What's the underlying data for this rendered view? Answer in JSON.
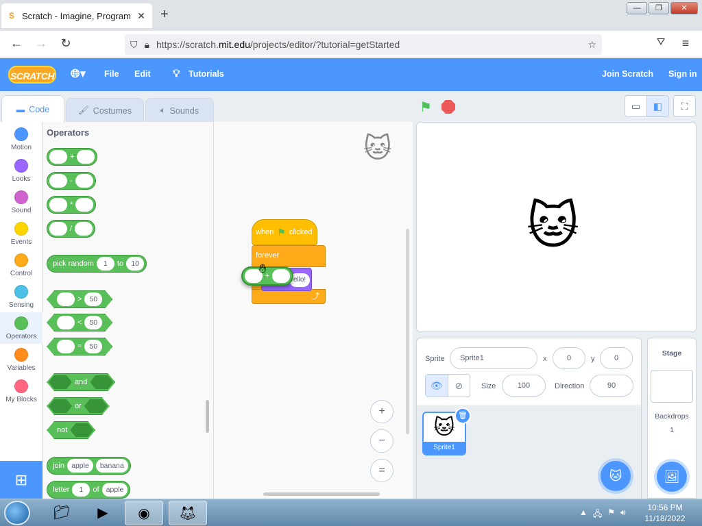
{
  "browser": {
    "tab_title": "Scratch - Imagine, Program, Sh",
    "url_prefix": "https://scratch.",
    "url_domain": "mit.edu",
    "url_path": "/projects/editor/?tutorial=getStarted"
  },
  "menu": {
    "logo": "SCRATCH",
    "file": "File",
    "edit": "Edit",
    "tutorials": "Tutorials",
    "join": "Join Scratch",
    "signin": "Sign in"
  },
  "editor_tabs": {
    "code": "Code",
    "costumes": "Costumes",
    "sounds": "Sounds"
  },
  "categories": [
    {
      "label": "Motion",
      "color": "#4c97ff"
    },
    {
      "label": "Looks",
      "color": "#9966ff"
    },
    {
      "label": "Sound",
      "color": "#cf63cf"
    },
    {
      "label": "Events",
      "color": "#ffd500"
    },
    {
      "label": "Control",
      "color": "#ffab19"
    },
    {
      "label": "Sensing",
      "color": "#4cbfe6"
    },
    {
      "label": "Operators",
      "color": "#59c059"
    },
    {
      "label": "Variables",
      "color": "#ff8c1a"
    },
    {
      "label": "My Blocks",
      "color": "#ff6680"
    }
  ],
  "palette": {
    "title": "Operators",
    "add": "+",
    "sub": "-",
    "mul": "*",
    "div": "/",
    "pick_random": "pick random",
    "pick_from": "1",
    "pick_to_label": "to",
    "pick_to": "10",
    "gt": ">",
    "lt": "<",
    "eq": "=",
    "cmp_value": "50",
    "and": "and",
    "or": "or",
    "not": "not",
    "join": "join",
    "join_a": "apple",
    "join_b": "banana",
    "letter": "letter",
    "letter_n": "1",
    "letter_of": "of",
    "letter_word": "apple"
  },
  "script": {
    "when": "when",
    "clicked": "clicked",
    "forever": "forever",
    "say_value": "ello!",
    "drag_op": "+"
  },
  "zoom": {
    "in": "+",
    "out": "−",
    "reset": "="
  },
  "sprite_info": {
    "sprite_label": "Sprite",
    "sprite_name": "Sprite1",
    "x_label": "x",
    "x_value": "0",
    "y_label": "y",
    "y_value": "0",
    "size_label": "Size",
    "size_value": "100",
    "direction_label": "Direction",
    "direction_value": "90"
  },
  "sprite_list": [
    {
      "name": "Sprite1"
    }
  ],
  "stage_pane": {
    "title": "Stage",
    "backdrops_label": "Backdrops",
    "backdrops_count": "1"
  },
  "taskbar": {
    "time": "10:56 PM",
    "date": "11/18/2022"
  }
}
